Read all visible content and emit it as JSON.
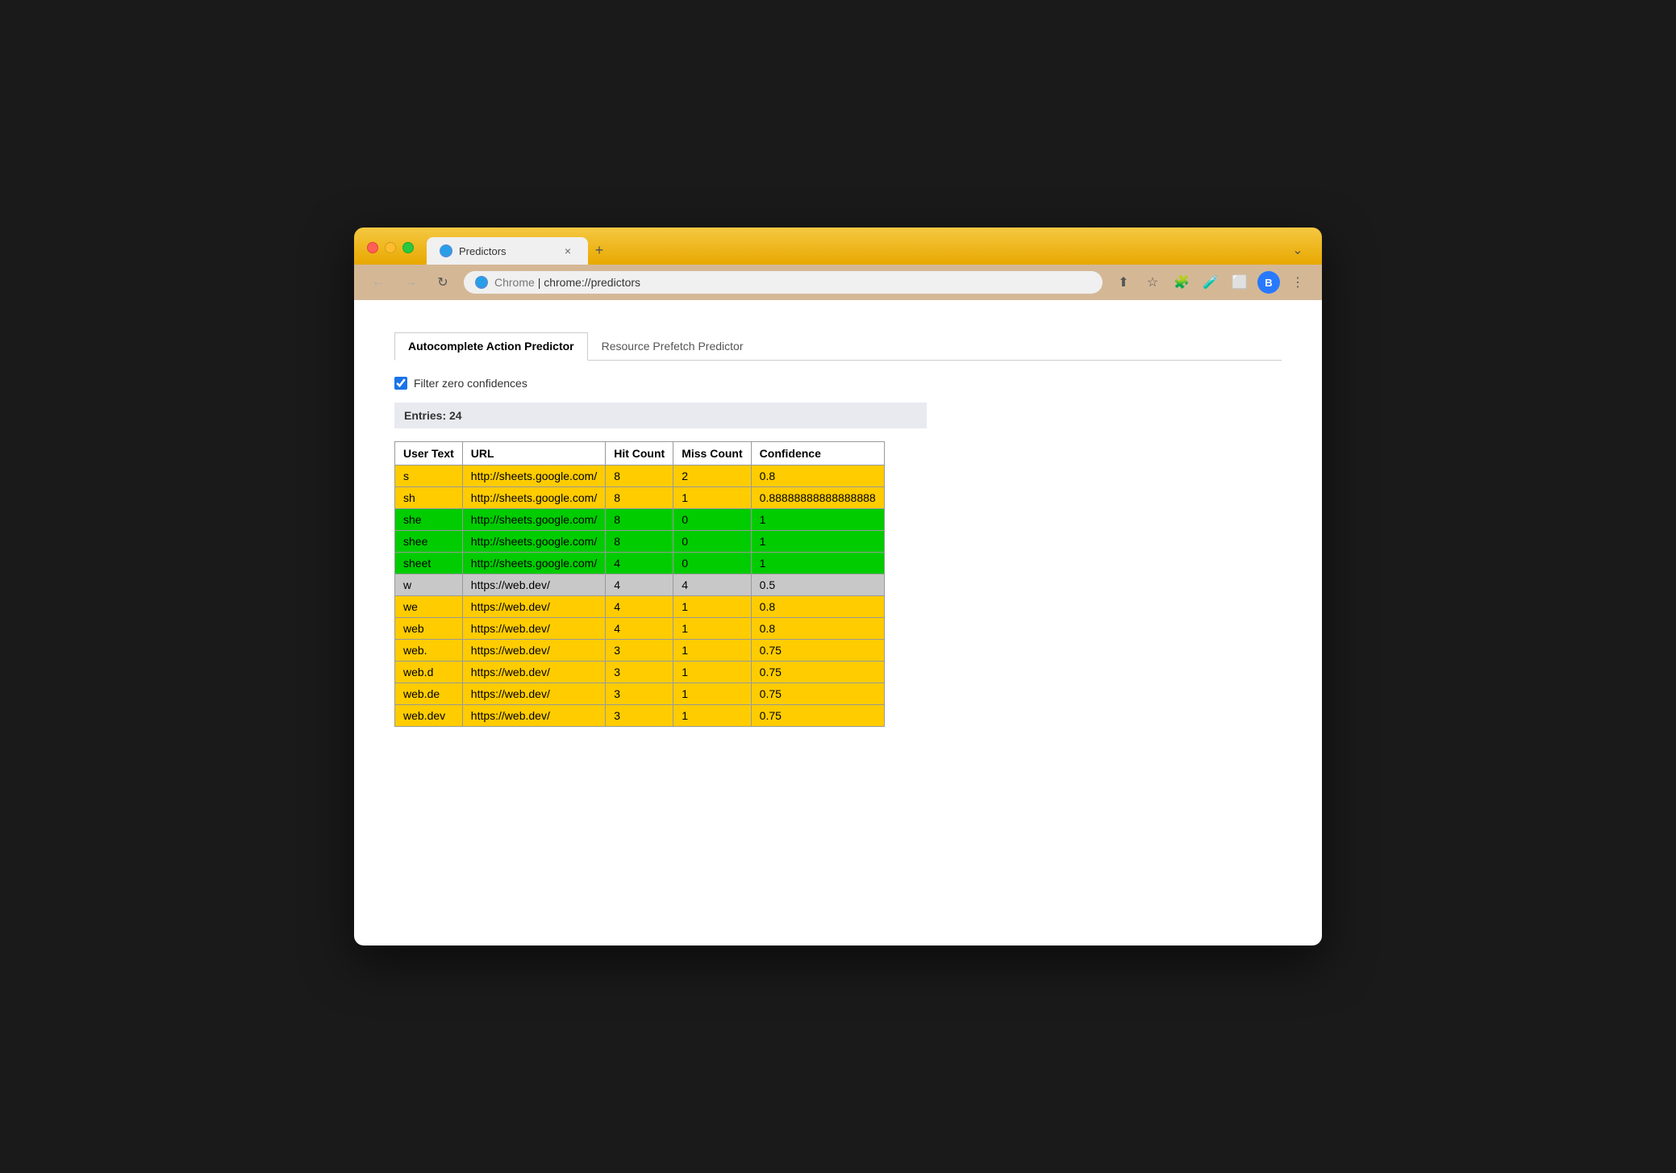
{
  "browser": {
    "tab_title": "Predictors",
    "tab_close": "×",
    "new_tab": "+",
    "chevron": "⌄",
    "favicon": "🌐",
    "nav_back": "←",
    "nav_forward": "→",
    "nav_reload": "↻",
    "address_brand": "Chrome",
    "address_separator": "|",
    "address_url": "chrome://predictors",
    "toolbar_share": "⬆",
    "toolbar_bookmark": "☆",
    "toolbar_extensions": "🧩",
    "toolbar_labs": "🧪",
    "toolbar_split": "⬜",
    "toolbar_profile": "B",
    "toolbar_menu": "⋮",
    "colors": {
      "titlebar": "#e8a800",
      "addressbar": "#d4b896"
    }
  },
  "page": {
    "tabs": [
      {
        "id": "autocomplete",
        "label": "Autocomplete Action Predictor",
        "active": true
      },
      {
        "id": "resource",
        "label": "Resource Prefetch Predictor",
        "active": false
      }
    ],
    "filter_label": "Filter zero confidences",
    "filter_checked": true,
    "entries_label": "Entries: 24",
    "table": {
      "headers": [
        "User Text",
        "URL",
        "Hit Count",
        "Miss Count",
        "Confidence"
      ],
      "rows": [
        {
          "user_text": "s",
          "url": "http://sheets.google.com/",
          "hit_count": "8",
          "miss_count": "2",
          "confidence": "0.8",
          "color": "yellow"
        },
        {
          "user_text": "sh",
          "url": "http://sheets.google.com/",
          "hit_count": "8",
          "miss_count": "1",
          "confidence": "0.88888888888888888",
          "color": "yellow"
        },
        {
          "user_text": "she",
          "url": "http://sheets.google.com/",
          "hit_count": "8",
          "miss_count": "0",
          "confidence": "1",
          "color": "green"
        },
        {
          "user_text": "shee",
          "url": "http://sheets.google.com/",
          "hit_count": "8",
          "miss_count": "0",
          "confidence": "1",
          "color": "green"
        },
        {
          "user_text": "sheet",
          "url": "http://sheets.google.com/",
          "hit_count": "4",
          "miss_count": "0",
          "confidence": "1",
          "color": "green"
        },
        {
          "user_text": "w",
          "url": "https://web.dev/",
          "hit_count": "4",
          "miss_count": "4",
          "confidence": "0.5",
          "color": "gray"
        },
        {
          "user_text": "we",
          "url": "https://web.dev/",
          "hit_count": "4",
          "miss_count": "1",
          "confidence": "0.8",
          "color": "yellow"
        },
        {
          "user_text": "web",
          "url": "https://web.dev/",
          "hit_count": "4",
          "miss_count": "1",
          "confidence": "0.8",
          "color": "yellow"
        },
        {
          "user_text": "web.",
          "url": "https://web.dev/",
          "hit_count": "3",
          "miss_count": "1",
          "confidence": "0.75",
          "color": "yellow"
        },
        {
          "user_text": "web.d",
          "url": "https://web.dev/",
          "hit_count": "3",
          "miss_count": "1",
          "confidence": "0.75",
          "color": "yellow"
        },
        {
          "user_text": "web.de",
          "url": "https://web.dev/",
          "hit_count": "3",
          "miss_count": "1",
          "confidence": "0.75",
          "color": "yellow"
        },
        {
          "user_text": "web.dev",
          "url": "https://web.dev/",
          "hit_count": "3",
          "miss_count": "1",
          "confidence": "0.75",
          "color": "yellow"
        }
      ]
    }
  }
}
